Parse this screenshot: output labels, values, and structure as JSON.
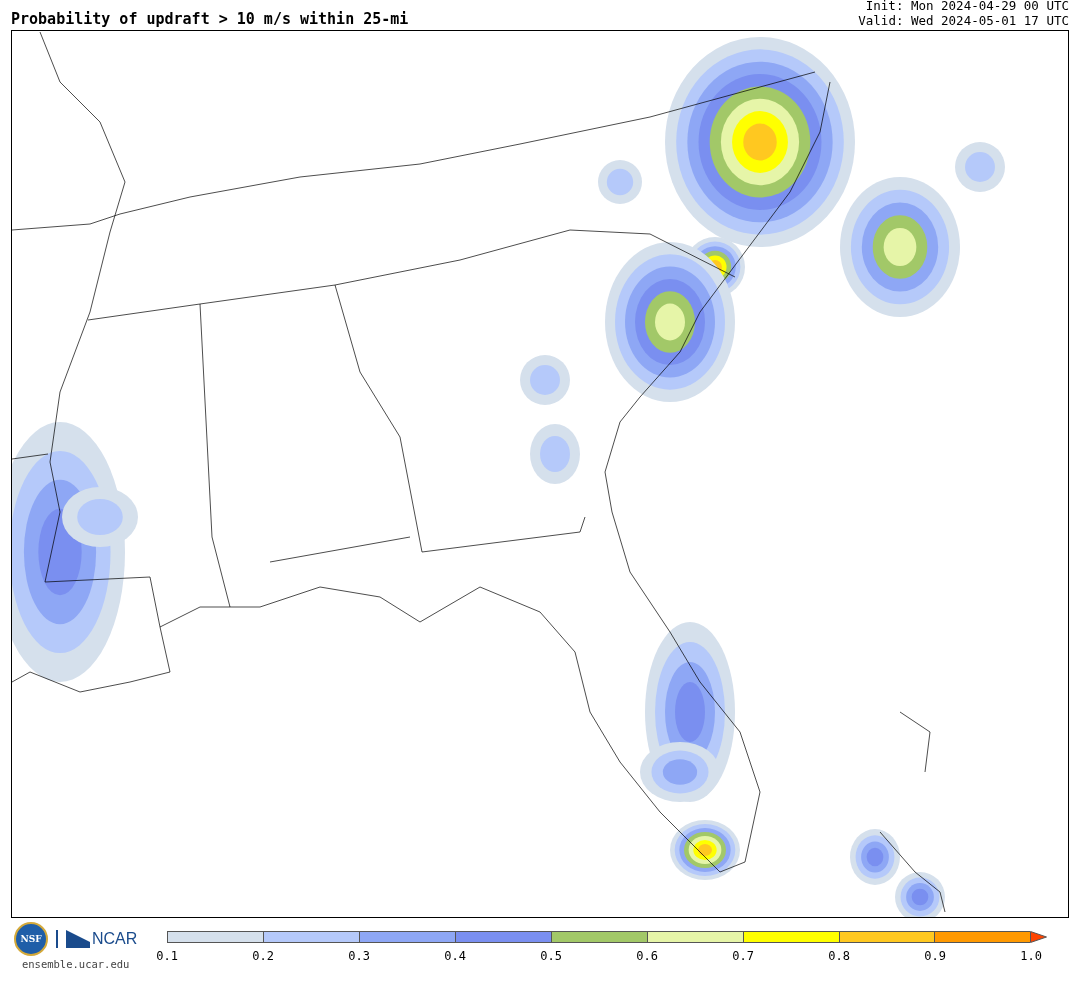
{
  "header": {
    "title": "Probability of updraft > 10 m/s within 25-mi",
    "init": "Init: Mon 2024-04-29 00 UTC",
    "valid": "Valid: Wed 2024-05-01 17 UTC"
  },
  "footer": {
    "logo_nsf": "NSF",
    "logo_ncar": "NCAR",
    "site": "ensemble.ucar.edu"
  },
  "colorbar": {
    "segments": [
      {
        "color": "#d5e0ec"
      },
      {
        "color": "#b5c9fa"
      },
      {
        "color": "#8ea7f5"
      },
      {
        "color": "#7a8ff0"
      },
      {
        "color": "#a2c868"
      },
      {
        "color": "#e6f5a8"
      },
      {
        "color": "#ffff00"
      },
      {
        "color": "#ffc820"
      },
      {
        "color": "#ff9900"
      },
      {
        "kind": "arrow",
        "color": "#ff4400"
      }
    ],
    "ticks": [
      "0.1",
      "0.2",
      "0.3",
      "0.4",
      "0.5",
      "0.6",
      "0.7",
      "0.8",
      "0.9",
      "1.0"
    ]
  }
}
